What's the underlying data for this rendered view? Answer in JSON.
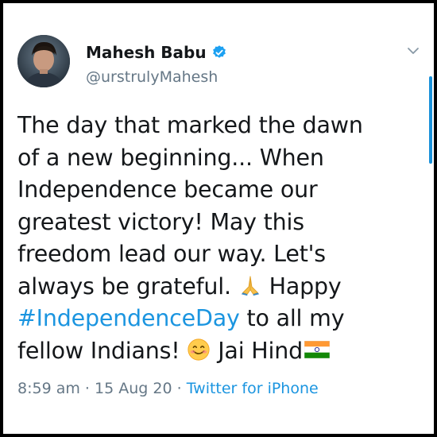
{
  "author": {
    "name": "Mahesh Babu",
    "handle": "@urstrulyMahesh"
  },
  "tweet": {
    "lines": [
      "The day that marked the dawn",
      "of a new beginning... When",
      "Independence became our",
      "greatest victory! May this",
      "freedom lead our way. Let's",
      "always be grateful."
    ],
    "happy": "Happy",
    "hashtag": "#IndependenceDay",
    "after_hashtag": "to all my",
    "closing_start": "fellow Indians!",
    "closing_end": "Jai Hind"
  },
  "meta": {
    "time": "8:59 am",
    "date": "15 Aug 20",
    "separator": "·",
    "source": "Twitter for iPhone"
  },
  "colors": {
    "link": "#1b95e0",
    "secondary_text": "#657786",
    "primary_text": "#14171a",
    "verified_badge": "#1da1f2"
  },
  "icons": {
    "verified": "verified-badge-icon",
    "caret": "chevron-down-icon",
    "emoji_1": "folded-hands-icon",
    "emoji_2": "smiling-face-icon",
    "emoji_3": "india-flag-icon"
  }
}
